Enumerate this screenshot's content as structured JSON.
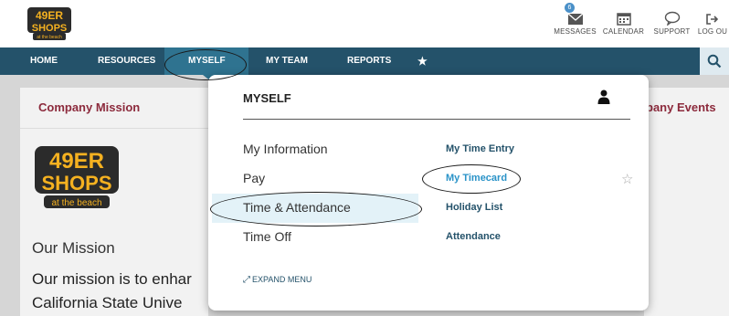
{
  "brand": {
    "logo_line1": "49ER",
    "logo_line2": "SHOPS",
    "logo_tagline": "at the beach"
  },
  "top_actions": [
    {
      "label": "MESSAGES",
      "icon": "envelope-icon",
      "badge": "6"
    },
    {
      "label": "CALENDAR",
      "icon": "calendar-icon"
    },
    {
      "label": "SUPPORT",
      "icon": "speech-bubble-icon"
    },
    {
      "label": "LOG OU",
      "icon": "logout-icon"
    }
  ],
  "nav": {
    "items": [
      {
        "label": "HOME"
      },
      {
        "label": "RESOURCES"
      },
      {
        "label": "MYSELF",
        "active": true
      },
      {
        "label": "MY TEAM"
      },
      {
        "label": "REPORTS"
      },
      {
        "label": "★"
      }
    ]
  },
  "dropdown": {
    "title": "MYSELF",
    "left_links": [
      "My Information",
      "Pay",
      "Time & Attendance",
      "Time Off"
    ],
    "right_links": [
      "My Time Entry",
      "My Timecard",
      "Holiday List",
      "Attendance"
    ],
    "expand_label": "EXPAND MENU"
  },
  "background": {
    "left_card_title": "Company Mission",
    "right_card_title": "pany Events",
    "mission_heading": "Our Mission",
    "mission_line1": "Our mission is to enhar",
    "mission_line2": "California State Unive"
  },
  "colors": {
    "nav": "#24526a",
    "nav_active": "#2f7390",
    "card_title": "#8c2a3c",
    "link": "#24526a",
    "link_highlight": "#2a93c8",
    "logo_fill": "#f5b120"
  }
}
